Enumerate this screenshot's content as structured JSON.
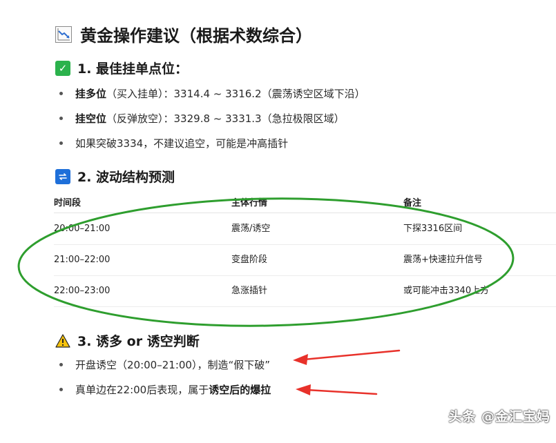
{
  "title": {
    "icon": "chart-decreasing-icon",
    "text": "黄金操作建议（根据术数综合）"
  },
  "section1": {
    "icon": "check-mark-icon",
    "heading": "1. 最佳挂单点位：",
    "bullets": [
      {
        "bold": "挂多位",
        "rest": "（买入挂单）：3314.4 ~ 3316.2（震荡诱空区域下沿）"
      },
      {
        "bold": "挂空位",
        "rest": "（反弹放空）：3329.8 ~ 3331.3（急拉极限区域）"
      },
      {
        "bold": "",
        "rest": "如果突破3334，不建议追空，可能是冲高插针"
      }
    ]
  },
  "section2": {
    "icon": "repeat-icon",
    "heading": "2. 波动结构预测",
    "table": {
      "headers": [
        "时间段",
        "主体行情",
        "备注"
      ],
      "rows": [
        [
          "20:00–21:00",
          "震荡/诱空",
          "下探3316区间"
        ],
        [
          "21:00–22:00",
          "变盘阶段",
          "震荡+快速拉升信号"
        ],
        [
          "22:00–23:00",
          "急涨插针",
          "或可能冲击3340上方"
        ]
      ]
    }
  },
  "section3": {
    "icon": "warning-icon",
    "heading": "3. 诱多 or 诱空判断",
    "bullets": [
      {
        "pre": "开盘诱空（20:00–21:00），制造“假下破”",
        "bold": ""
      },
      {
        "pre": "真单边在22:00后表现，属于",
        "bold": "诱空后的爆拉"
      }
    ]
  },
  "watermark": "头条 @金汇宝妈",
  "colors": {
    "annotation_circle": "#2e9e2e",
    "annotation_arrow": "#e8312a"
  }
}
